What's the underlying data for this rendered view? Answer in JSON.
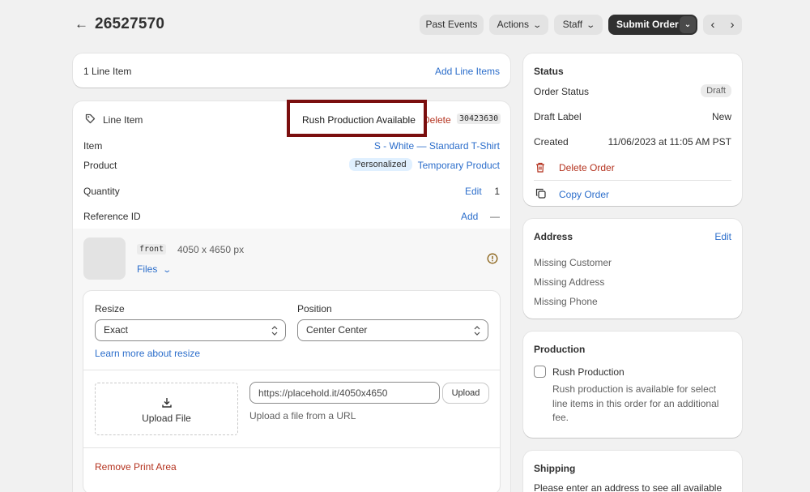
{
  "header": {
    "back_icon": "arrow-left-icon",
    "title": "26527570",
    "past_events": "Past Events",
    "actions": "Actions",
    "staff": "Staff",
    "submit": "Submit Order"
  },
  "line_items_summary": {
    "count_label": "1 Line Item",
    "add_link": "Add Line Items"
  },
  "line_item": {
    "title": "Line Item",
    "rush_label": "Rush Production Available",
    "delete": "Delete",
    "id_code": "30423630",
    "item_label": "Item",
    "item_value": "S - White — Standard T-Shirt",
    "product_label": "Product",
    "product_badge": "Personalized",
    "product_value": "Temporary Product",
    "quantity_label": "Quantity",
    "quantity_edit": "Edit",
    "quantity_value": "1",
    "reference_label": "Reference ID",
    "reference_add": "Add",
    "reference_value": "—",
    "print_area": {
      "placement_tag": "front",
      "dimensions": "4050 x 4650 px",
      "files_label": "Files",
      "resize_label": "Resize",
      "resize_value": "Exact",
      "position_label": "Position",
      "position_value": "Center Center",
      "learn_more": "Learn more about resize",
      "upload_file": "Upload File",
      "url_value": "https://placehold.it/4050x4650",
      "upload_button": "Upload",
      "url_help": "Upload a file from a URL",
      "remove": "Remove Print Area"
    }
  },
  "status": {
    "heading": "Status",
    "order_status_label": "Order Status",
    "order_status_badge": "Draft",
    "draft_label_label": "Draft Label",
    "draft_label_value": "New",
    "created_label": "Created",
    "created_value": "11/06/2023 at 11:05 AM PST",
    "delete_order": "Delete Order",
    "copy_order": "Copy Order"
  },
  "address": {
    "heading": "Address",
    "edit": "Edit",
    "missing_customer": "Missing Customer",
    "missing_address": "Missing Address",
    "missing_phone": "Missing Phone"
  },
  "production": {
    "heading": "Production",
    "rush_label": "Rush Production",
    "rush_help": "Rush production is available for select line items in this order for an additional fee."
  },
  "shipping": {
    "heading": "Shipping",
    "text": "Please enter an address to see all available"
  },
  "colors": {
    "accent": "#2c6ecb",
    "danger": "#b4321e",
    "highlight": "#7a0e0e",
    "primary_btn": "#303030"
  }
}
